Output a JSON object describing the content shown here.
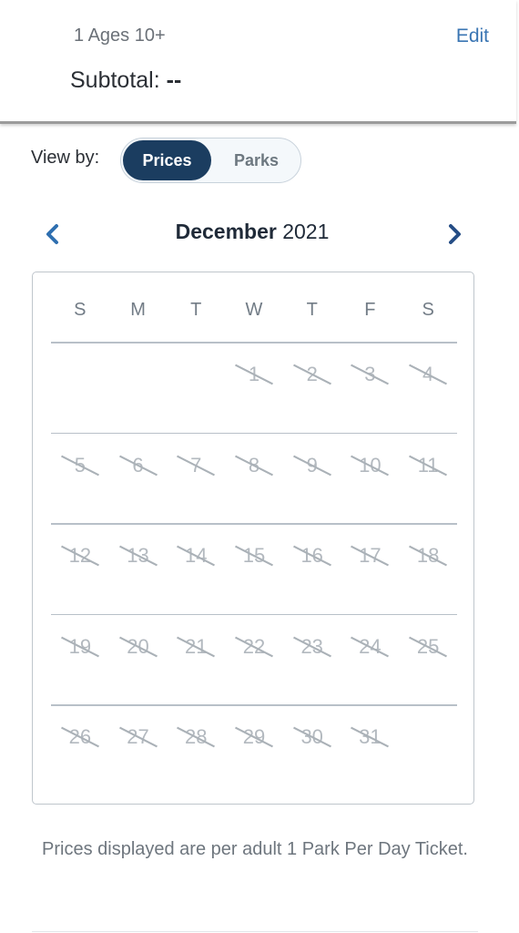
{
  "header": {
    "party": "1 Ages 10+",
    "edit_label": "Edit",
    "subtotal_label": "Subtotal:",
    "subtotal_value": "--"
  },
  "view_by": {
    "label": "View by:",
    "options": [
      {
        "label": "Prices",
        "selected": true
      },
      {
        "label": "Parks",
        "selected": false
      }
    ]
  },
  "calendar": {
    "month": "December",
    "year": "2021",
    "prev_icon": "chevron-left-icon",
    "next_icon": "chevron-right-icon",
    "weekdays": [
      "S",
      "M",
      "T",
      "W",
      "T",
      "F",
      "S"
    ],
    "first_weekday_index": 3,
    "days": [
      "1",
      "2",
      "3",
      "4",
      "5",
      "6",
      "7",
      "8",
      "9",
      "10",
      "11",
      "12",
      "13",
      "14",
      "15",
      "16",
      "17",
      "18",
      "19",
      "20",
      "21",
      "22",
      "23",
      "24",
      "25",
      "26",
      "27",
      "28",
      "29",
      "30",
      "31"
    ],
    "unavailable": true
  },
  "colors": {
    "accent": "#1b3d60",
    "link": "#3a75b3",
    "chevron_prev": "#2f6fb0",
    "chevron_next": "#254d85"
  },
  "footnote": "Prices displayed are per adult 1 Park Per Day Ticket."
}
